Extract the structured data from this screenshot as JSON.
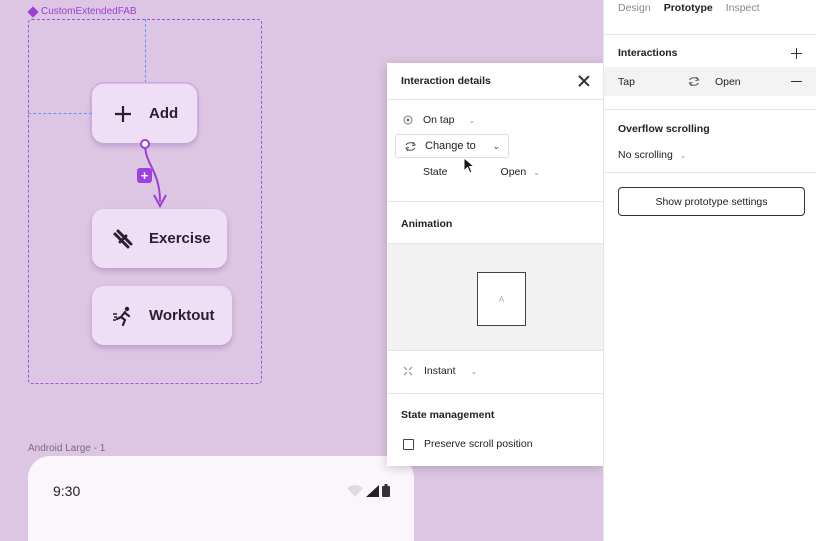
{
  "canvas": {
    "component_label": "CustomExtendedFAB",
    "fab_add_label": "Add",
    "fab_exercise_label": "Exercise",
    "fab_workout_label": "Worktout",
    "connection_plus": "+",
    "android_frame_label": "Android Large - 1",
    "android_time": "9:30",
    "accent_color": "#9b3fd6"
  },
  "interaction_details": {
    "title": "Interaction details",
    "trigger": "On tap",
    "action": "Change to",
    "state_label": "State",
    "state_value": "Open",
    "animation_title": "Animation",
    "preview_letter": "A",
    "animation_type": "Instant",
    "state_management_title": "State management",
    "preserve_scroll_label": "Preserve scroll position"
  },
  "right_panel": {
    "tabs": [
      "Design",
      "Prototype",
      "Inspect"
    ],
    "active_tab": "Prototype",
    "interactions_title": "Interactions",
    "interaction_trigger": "Tap",
    "interaction_destination": "Open",
    "overflow_title": "Overflow scrolling",
    "overflow_value": "No scrolling",
    "settings_button": "Show prototype settings"
  }
}
